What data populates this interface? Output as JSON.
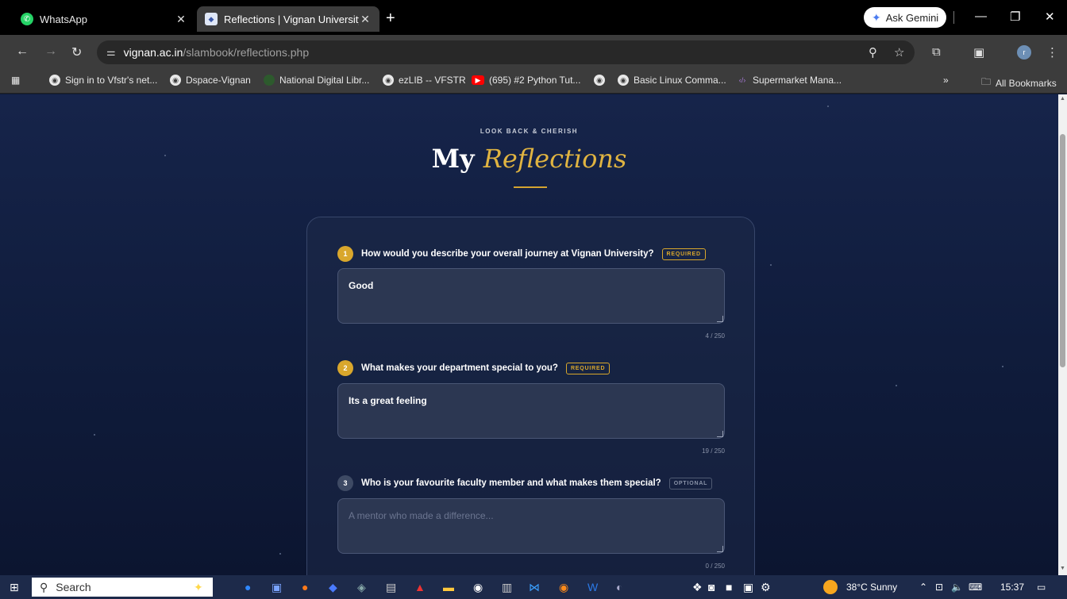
{
  "browser": {
    "tabs": [
      {
        "label": "WhatsApp",
        "active": false,
        "icon": "whatsapp-icon"
      },
      {
        "label": "Reflections | Vignan University",
        "active": true,
        "icon": "vignan-favicon"
      }
    ],
    "new_tab": "+",
    "gemini_label": "Ask Gemini",
    "url_host": "vignan.ac.in",
    "url_path": "/slambook/reflections.php",
    "profile_initial": "r",
    "bookmarks": [
      "Sign in to Vfstr's net...",
      "Dspace-Vignan",
      "National Digital Libr...",
      "ezLIB -- VFSTR",
      "(695) #2 Python Tut...",
      "",
      "Basic Linux Comma...",
      "Supermarket Mana..."
    ],
    "more_bookmarks": "»",
    "all_bookmarks": "All Bookmarks"
  },
  "page": {
    "eyebrow": "LOOK BACK & CHERISH",
    "title_plain": "My",
    "title_accent": "Reflections",
    "accent_color": "#e0b441",
    "questions": [
      {
        "num": "1",
        "text": "How would you describe your overall journey at Vignan University?",
        "tag": "REQUIRED",
        "answer": "Good",
        "placeholder": "",
        "count": "4 / 250"
      },
      {
        "num": "2",
        "text": "What makes your department special to you?",
        "tag": "REQUIRED",
        "answer": "Its a great feeling",
        "placeholder": "",
        "count": "19 / 250"
      },
      {
        "num": "3",
        "text": "Who is your favourite faculty member and what makes them special?",
        "tag": "OPTIONAL",
        "answer": "",
        "placeholder": "A mentor who made a difference...",
        "count": "0 / 250"
      }
    ]
  },
  "taskbar": {
    "search_label": "Search",
    "weather": "38°C  Sunny",
    "time": "15:37"
  }
}
